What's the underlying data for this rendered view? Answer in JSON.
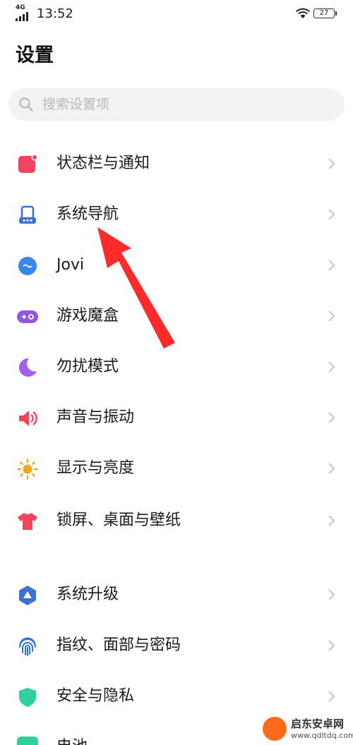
{
  "status_bar": {
    "network": "4G",
    "time": "13:52",
    "battery": "27"
  },
  "page": {
    "title": "设置"
  },
  "search": {
    "placeholder": "搜索设置项",
    "value": ""
  },
  "settings": {
    "items": [
      {
        "label": "状态栏与通知",
        "icon": "notification-icon",
        "color": "#f3445d"
      },
      {
        "label": "系统导航",
        "icon": "navigation-icon",
        "color": "#3c6fd8"
      },
      {
        "label": "Jovi",
        "icon": "jovi-icon",
        "color": "#3a86f0"
      },
      {
        "label": "游戏魔盒",
        "icon": "game-box-icon",
        "color": "#8f56e8"
      },
      {
        "label": "勿扰模式",
        "icon": "moon-icon",
        "color": "#a45ee8"
      },
      {
        "label": "声音与振动",
        "icon": "speaker-icon",
        "color": "#f3445d"
      },
      {
        "label": "显示与亮度",
        "icon": "sun-icon",
        "color": "#f7a325"
      },
      {
        "label": "锁屏、桌面与壁纸",
        "icon": "shirt-icon",
        "color": "#f3445d"
      },
      {
        "label": "系统升级",
        "icon": "upgrade-icon",
        "color": "#3c6fd8"
      },
      {
        "label": "指纹、面部与密码",
        "icon": "fingerprint-icon",
        "color": "#2f6fe0"
      },
      {
        "label": "安全与隐私",
        "icon": "shield-icon",
        "color": "#2ed19b"
      }
    ],
    "partial_item": {
      "label": "电池",
      "icon": "battery-icon",
      "color": "#2ed19b"
    }
  },
  "watermark": {
    "title": "启东安卓网",
    "url": "www.qdltdq.com"
  }
}
